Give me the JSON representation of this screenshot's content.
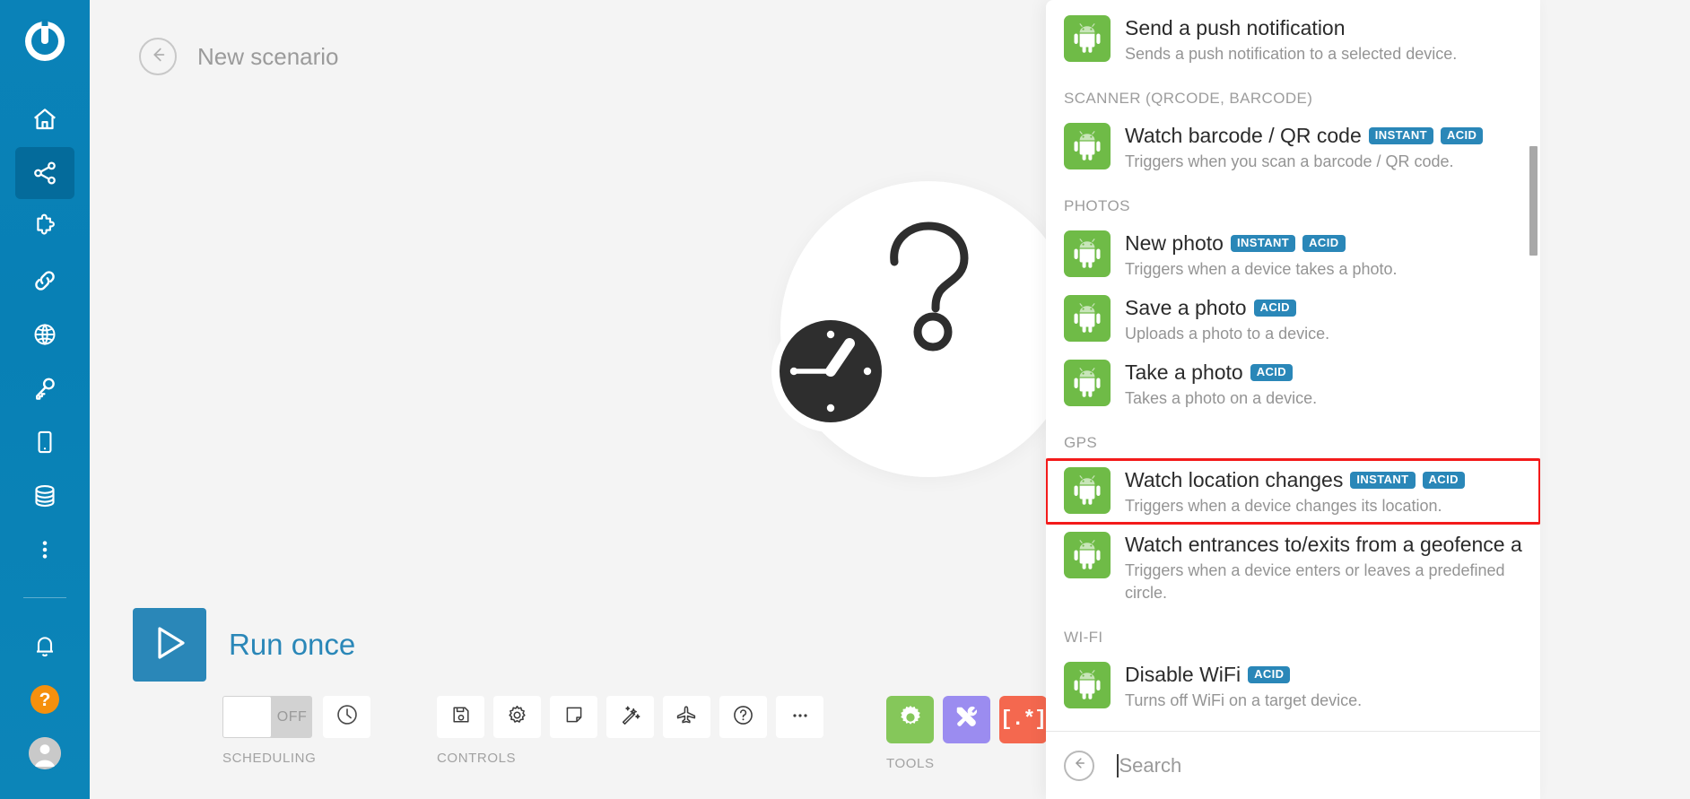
{
  "app": {
    "brand_icon": "integromat-logo-icon",
    "accent_blue": "#2a87b8",
    "sidebar_blue": "#0880b5",
    "android_green": "#6fbb47",
    "highlight_red": "#f31a1a",
    "help_orange": "#f5900d"
  },
  "sidebar": {
    "logo_label": "Integromat",
    "items": [
      {
        "name": "home",
        "icon": "home-icon",
        "active": false
      },
      {
        "name": "scenarios",
        "icon": "share-icon",
        "active": true
      },
      {
        "name": "templates",
        "icon": "puzzle-icon",
        "active": false
      },
      {
        "name": "connections",
        "icon": "link-icon",
        "active": false
      },
      {
        "name": "webhooks",
        "icon": "globe-icon",
        "active": false
      },
      {
        "name": "keys",
        "icon": "key-icon",
        "active": false
      },
      {
        "name": "devices",
        "icon": "mobile-icon",
        "active": false
      },
      {
        "name": "data-stores",
        "icon": "database-icon",
        "active": false
      },
      {
        "name": "more",
        "icon": "more-vertical-icon",
        "active": false
      }
    ],
    "bottom_items": [
      {
        "name": "notifications",
        "icon": "bell-icon"
      },
      {
        "name": "help",
        "icon": "question-mark-icon",
        "label": "?"
      },
      {
        "name": "account",
        "icon": "user-avatar-icon"
      }
    ]
  },
  "header": {
    "back_icon": "arrow-left-circle-icon",
    "title": "New scenario"
  },
  "canvas": {
    "placeholder_icons": [
      "question-mark-icon",
      "clock-icon"
    ]
  },
  "toolbar": {
    "run_once_label": "Run once",
    "run_icon": "play-triangle-icon",
    "scheduling": {
      "group_label": "SCHEDULING",
      "toggle_state": "OFF",
      "clock_icon": "clock-icon"
    },
    "controls": {
      "group_label": "CONTROLS",
      "buttons": [
        {
          "name": "save",
          "icon": "floppy-save-icon"
        },
        {
          "name": "settings",
          "icon": "gear-icon"
        },
        {
          "name": "notes",
          "icon": "note-icon"
        },
        {
          "name": "auto-align",
          "icon": "magic-wand-icon"
        },
        {
          "name": "explore",
          "icon": "paper-plane-icon"
        },
        {
          "name": "help",
          "icon": "question-circle-icon"
        },
        {
          "name": "more",
          "icon": "ellipsis-icon"
        }
      ]
    },
    "tools": {
      "group_label": "TOOLS",
      "buttons": [
        {
          "name": "tools-gear",
          "icon": "gear-icon",
          "color": "#85c75a"
        },
        {
          "name": "tools-repair",
          "icon": "tools-cross-icon",
          "color": "#9b8cf0"
        },
        {
          "name": "tools-regex",
          "icon": "regex-icon",
          "color": "#f4684f",
          "glyph": "[.*]"
        }
      ]
    }
  },
  "module_panel": {
    "scroll_thumb": {
      "top_pct": 20,
      "height_pct": 15
    },
    "sections": [
      {
        "label": "",
        "items": [
          {
            "title": "Send a push notification",
            "desc": "Sends a push notification to a selected device.",
            "badges": [],
            "icon": "android-icon",
            "highlighted": false
          }
        ]
      },
      {
        "label": "SCANNER (QRCODE, BARCODE)",
        "items": [
          {
            "title": "Watch barcode / QR code",
            "desc": "Triggers when you scan a barcode / QR code.",
            "badges": [
              "INSTANT",
              "ACID"
            ],
            "icon": "android-icon",
            "highlighted": false
          }
        ]
      },
      {
        "label": "PHOTOS",
        "items": [
          {
            "title": "New photo",
            "desc": "Triggers when a device takes a photo.",
            "badges": [
              "INSTANT",
              "ACID"
            ],
            "icon": "android-icon",
            "highlighted": false
          },
          {
            "title": "Save a photo",
            "desc": "Uploads a photo to a device.",
            "badges": [
              "ACID"
            ],
            "icon": "android-icon",
            "highlighted": false
          },
          {
            "title": "Take a photo",
            "desc": "Takes a photo on a device.",
            "badges": [
              "ACID"
            ],
            "icon": "android-icon",
            "highlighted": false
          }
        ]
      },
      {
        "label": "GPS",
        "items": [
          {
            "title": "Watch location changes",
            "desc": "Triggers when a device changes its location.",
            "badges": [
              "INSTANT",
              "ACID"
            ],
            "icon": "android-icon",
            "highlighted": true
          },
          {
            "title": "Watch entrances to/exits from a geofence a",
            "desc": "Triggers when a device enters or leaves a predefined circle.",
            "badges": [],
            "icon": "android-icon",
            "highlighted": false
          }
        ]
      },
      {
        "label": "WI-FI",
        "items": [
          {
            "title": "Disable WiFi",
            "desc": "Turns off WiFi on a target device.",
            "badges": [
              "ACID"
            ],
            "icon": "android-icon",
            "highlighted": false
          }
        ]
      }
    ],
    "search": {
      "back_icon": "arrow-left-circle-icon",
      "placeholder": "Search",
      "value": ""
    }
  }
}
